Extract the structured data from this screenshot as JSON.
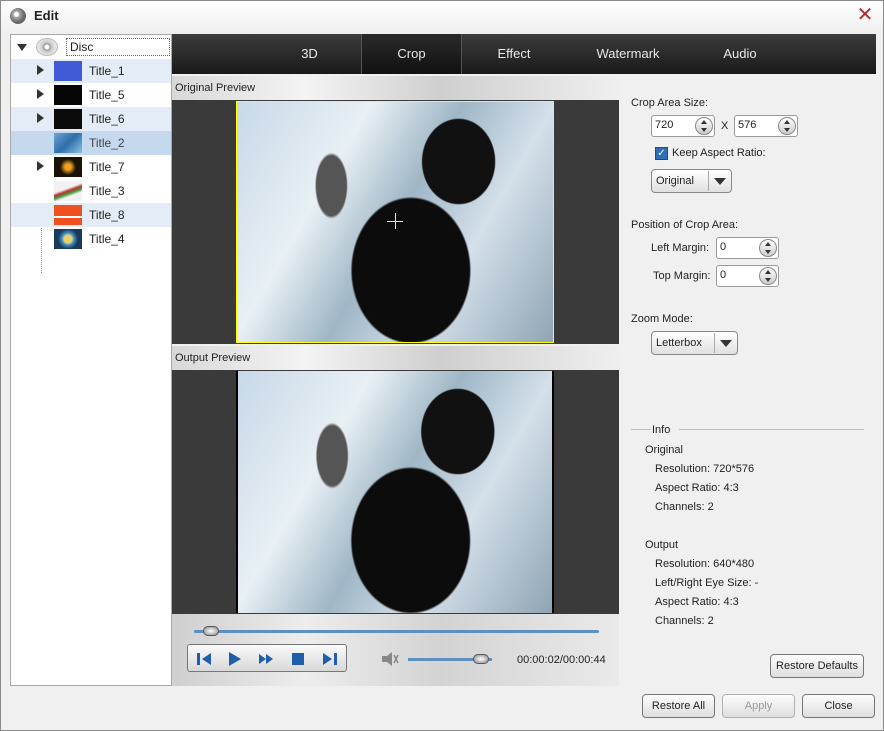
{
  "window": {
    "title": "Edit"
  },
  "tree": {
    "root_label": "Disc",
    "items": [
      {
        "label": "Title_1",
        "has_children": true,
        "thumb": "#3f5bd6"
      },
      {
        "label": "Title_5",
        "has_children": true,
        "thumb": "#050505"
      },
      {
        "label": "Title_6",
        "has_children": true,
        "thumb": "#0a0a0a"
      },
      {
        "label": "Title_2",
        "has_children": false,
        "thumb": "#2f6ea8"
      },
      {
        "label": "Title_7",
        "has_children": true,
        "thumb": "#1a1206"
      },
      {
        "label": "Title_3",
        "has_children": false,
        "thumb": "#f2f2f2"
      },
      {
        "label": "Title_8",
        "has_children": false,
        "thumb": "#f05020"
      },
      {
        "label": "Title_4",
        "has_children": false,
        "thumb": "#2a5f8c"
      }
    ]
  },
  "tabs": [
    {
      "label": "3D"
    },
    {
      "label": "Crop"
    },
    {
      "label": "Effect"
    },
    {
      "label": "Watermark"
    },
    {
      "label": "Audio"
    }
  ],
  "preview": {
    "original_label": "Original Preview",
    "output_label": "Output Preview"
  },
  "player": {
    "timecode": "00:00:02/00:00:44",
    "seek_fraction": 0.03,
    "volume_fraction": 0.85
  },
  "crop": {
    "area_size_label": "Crop Area Size:",
    "width": "720",
    "x_sep": "X",
    "height": "576",
    "keep_aspect_label": "Keep Aspect Ratio:",
    "keep_aspect_checked": true,
    "aspect_value": "Original",
    "position_label": "Position of Crop Area:",
    "left_margin_label": "Left Margin:",
    "left_margin": "0",
    "top_margin_label": "Top Margin:",
    "top_margin": "0",
    "zoom_mode_label": "Zoom Mode:",
    "zoom_mode": "Letterbox"
  },
  "info": {
    "header": "Info",
    "original_title": "Original",
    "original_resolution": "Resolution: 720*576",
    "original_aspect": "Aspect Ratio: 4:3",
    "original_channels": "Channels: 2",
    "output_title": "Output",
    "output_resolution": "Resolution: 640*480",
    "output_eye_size": "Left/Right Eye Size: -",
    "output_aspect": "Aspect Ratio: 4:3",
    "output_channels": "Channels: 2"
  },
  "buttons": {
    "restore_defaults": "Restore Defaults",
    "restore_all": "Restore All",
    "apply": "Apply",
    "close": "Close"
  },
  "colors": {
    "crop_frame": "#ffff00",
    "accent": "#2e6fb8"
  }
}
